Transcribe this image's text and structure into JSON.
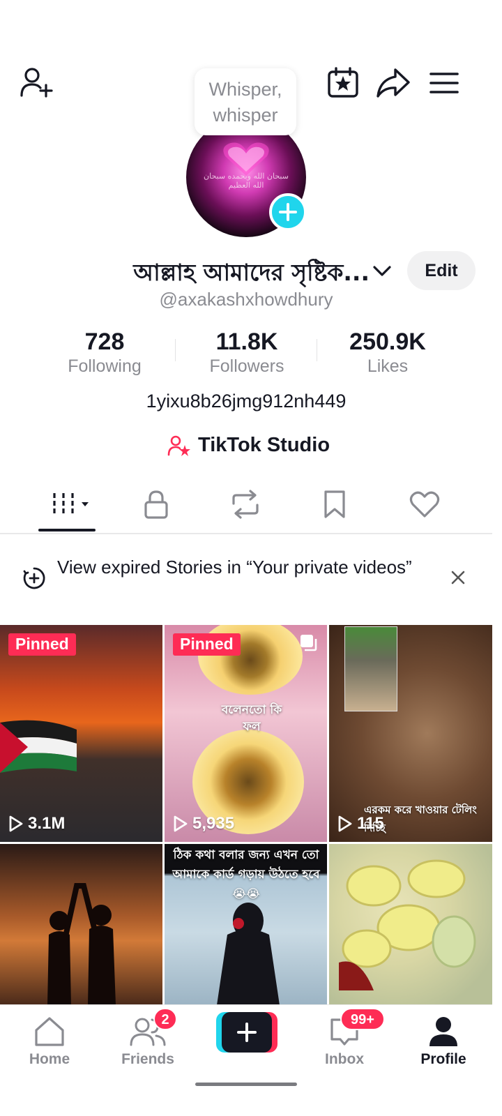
{
  "header": {
    "add_friend_icon": "person-plus-icon",
    "calendar_icon": "calendar-star-icon",
    "share_icon": "share-arrow-icon",
    "menu_icon": "hamburger-menu-icon"
  },
  "tooltip": {
    "text_line1": "Whisper,",
    "text_line2": "whisper"
  },
  "profile": {
    "display_name": "আল্লাহ আমাদের সৃষ্টিক...",
    "handle": "@axakashxhowdhury",
    "edit_label": "Edit",
    "bio": "1yixu8b26jmg912nh449",
    "studio_label": "TikTok Studio",
    "avatar_caption": "سبحان الله وبحمده سبحان الله العظيم"
  },
  "stats": [
    {
      "value": "728",
      "label": "Following"
    },
    {
      "value": "11.8K",
      "label": "Followers"
    },
    {
      "value": "250.9K",
      "label": "Likes"
    }
  ],
  "tabs": [
    "videos-grid",
    "private",
    "reposts",
    "favorites",
    "liked"
  ],
  "notice": {
    "text": "View expired Stories in “Your private videos”"
  },
  "videos": [
    {
      "pinned": "Pinned",
      "views": "3.1M"
    },
    {
      "pinned": "Pinned",
      "views": "5,935",
      "caption": "বলেনতো কি ফল"
    },
    {
      "views": "115",
      "caption": "এরকম করে খাওয়ার টেলিং দিচ্ছি"
    },
    {
      "views": ""
    },
    {
      "views": "",
      "caption": "ঠিক কথা বলার জন্য এখন তো আমাকে কার্ড গড়ায় উঠতে হবে 😭😭"
    },
    {
      "views": ""
    }
  ],
  "nav": {
    "home": "Home",
    "friends": "Friends",
    "friends_badge": "2",
    "inbox": "Inbox",
    "inbox_badge": "99+",
    "profile": "Profile"
  },
  "colors": {
    "accent": "#fe2c55",
    "cyan": "#20d5ec",
    "text": "#161823",
    "muted": "#8a8b91"
  }
}
